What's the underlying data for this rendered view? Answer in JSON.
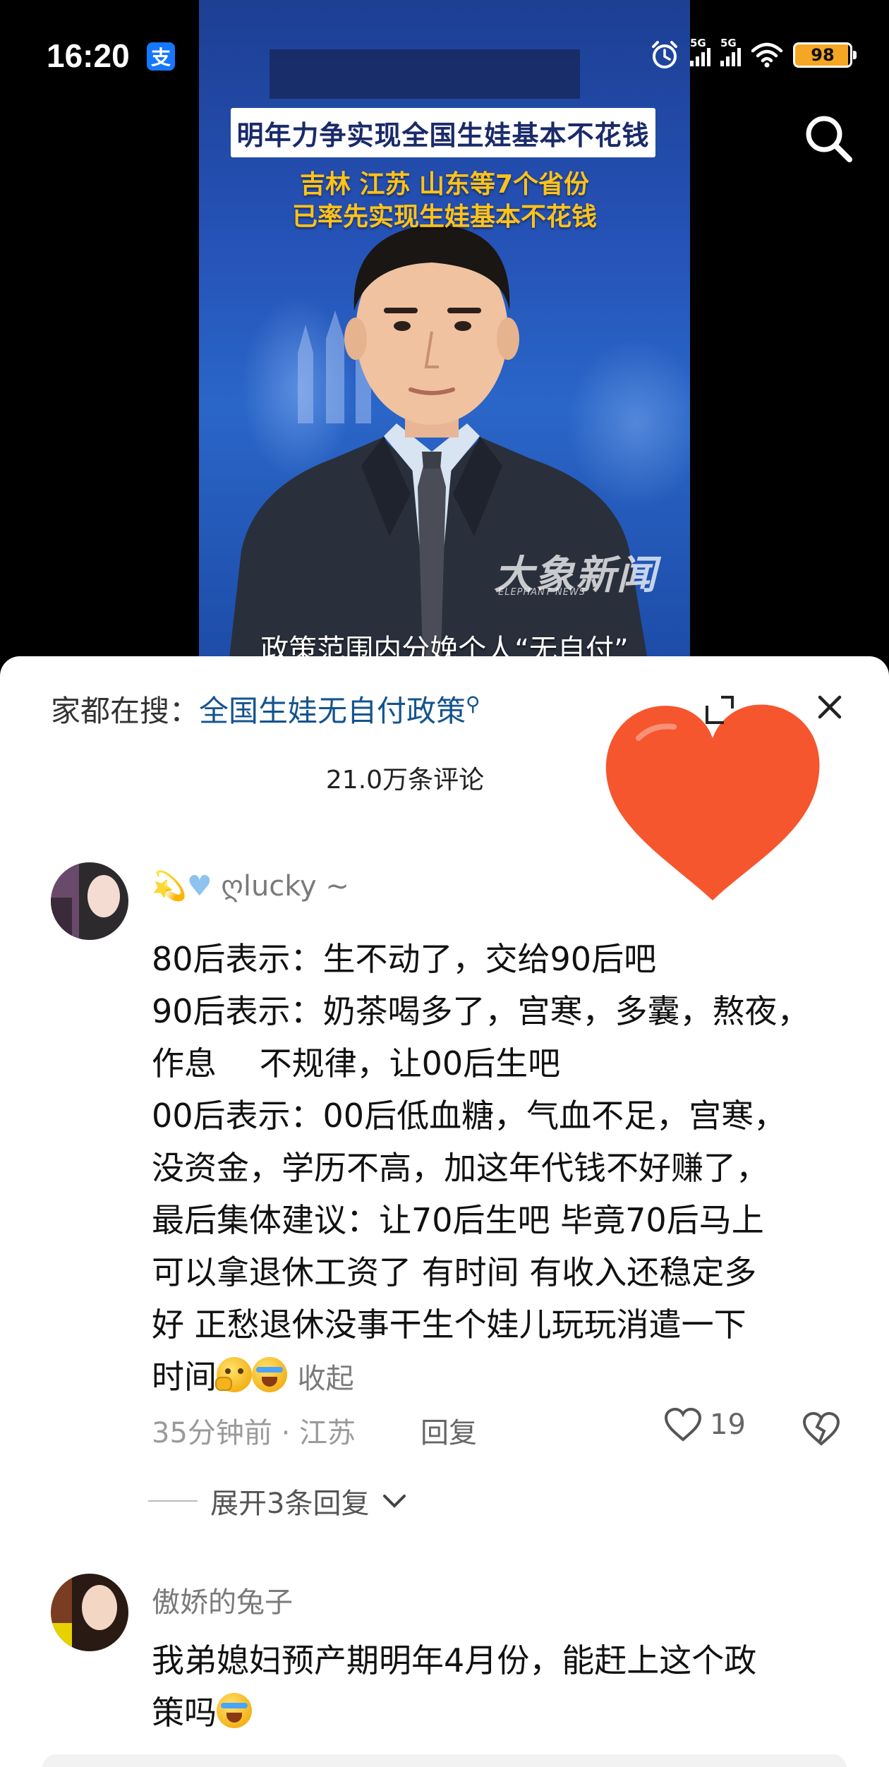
{
  "status_bar": {
    "time": "16:20",
    "alipay_icon": "支",
    "signal_1_label": "5G",
    "signal_2_label": "5G",
    "battery": "98",
    "icons": [
      "alarm-icon",
      "signal-icon",
      "wifi-icon",
      "battery-icon"
    ]
  },
  "video": {
    "headline": "明年力争实现全国生娃基本不花钱",
    "subtitle_line1": "吉林 江苏 山东等7个省份",
    "subtitle_line2": "已率先实现生娃基本不花钱",
    "watermark": "大象新闻",
    "watermark_sub": "ELEPHANT NEWS",
    "caption": "政策范围内分娩个人“无自付”",
    "search_icon": "search-icon"
  },
  "comments_panel": {
    "search_prefix": "家都在搜：",
    "search_query": "全国生娃无自付政策",
    "comment_count": "21.0万条评论",
    "expand_icon": "expand-icon",
    "close_icon": "close-icon",
    "sticker": "heart-sticker"
  },
  "comments": [
    {
      "username": "ღlucky",
      "lines": [
        "80后表示：生不动了，交给90后吧",
        "90后表示：奶茶喝多了，宫寒，多囊，熬夜，",
        "作息　 不规律，让00后生吧",
        "00后表示：00后低血糖，气血不足，宫寒，",
        "没资金，学历不高，加这年代钱不好赚了，",
        "最后集体建议：让70后生吧 毕竟70后马上",
        "可以拿退休工资了 有时间 有收入还稳定多",
        "好 正愁退休没事干生个娃儿玩玩消遣一下",
        "时间"
      ],
      "fold_label": "收起",
      "time_location": "35分钟前 · 江苏",
      "reply_label": "回复",
      "likes": "19",
      "expand_replies": "展开3条回复"
    },
    {
      "username": "傲娇的兔子",
      "lines": [
        "我弟媳妇预产期明年4月份，能赶上这个政",
        "策吗"
      ]
    }
  ],
  "colors": {
    "accent_link": "#14548f",
    "battery": "#f5a623",
    "headline_yellow": "#ffc21a",
    "sticker_red": "#f5562e"
  }
}
